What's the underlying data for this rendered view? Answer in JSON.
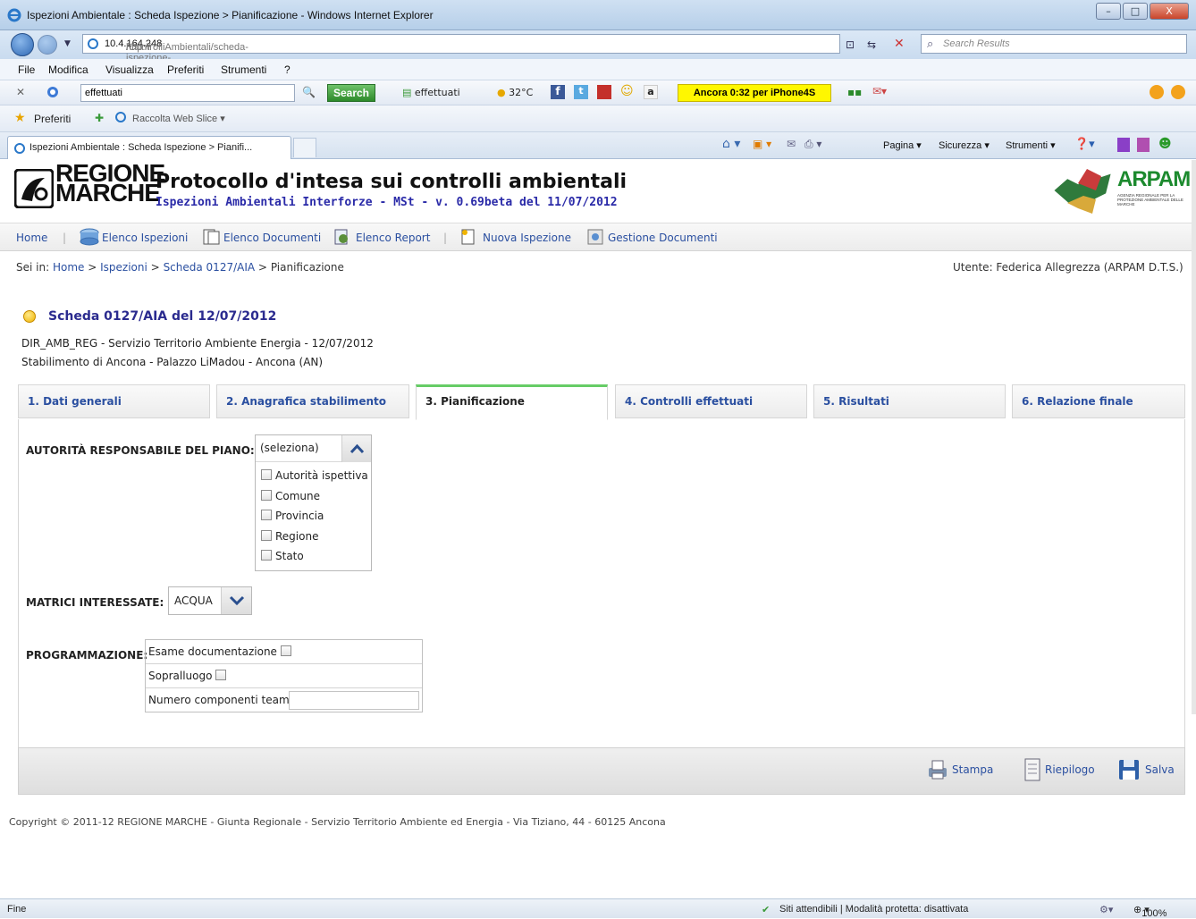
{
  "window": {
    "title": "Ispezioni Ambientale : Scheda Ispezione > Pianificazione - Windows Internet Explorer",
    "minimize": "–",
    "maximize": "□",
    "close": "X"
  },
  "address": {
    "url_prefix": "http://",
    "url_host": "10.4.164.248",
    "url_path": "/ControlliAmbientali/scheda-ispezione-pianificazione.aspx?ispIdIspezione=2764",
    "search_placeholder": "Search Results"
  },
  "menu": [
    "File",
    "Modifica",
    "Visualizza",
    "Preferiti",
    "Strumenti",
    "?"
  ],
  "toolbar": {
    "search_value": "effettuati",
    "search_button": "Search",
    "item_effettuati": "effettuati",
    "temperature": "32°C",
    "promo": "Ancora 0:32 per iPhone4S"
  },
  "favorites": {
    "preferiti": "Preferiti",
    "web_slice": "Raccolta Web Slice ▾"
  },
  "browser_tab": {
    "label": "Ispezioni Ambientale : Scheda Ispezione > Pianifi...",
    "commands": [
      "Pagina ▾",
      "Sicurezza ▾",
      "Strumenti ▾"
    ]
  },
  "site": {
    "logo_line1": "REGIONE",
    "logo_line2": "MARCHE",
    "title": "Protocollo d'intesa sui controlli ambientali",
    "subtitle": "Ispezioni Ambientali Interforze - MSt - v. 0.69beta del 11/07/2012",
    "partner_logo": "ARPAM",
    "partner_caption": "AGENZIA REGIONALE PER LA PROTEZIONE AMBIENTALE DELLE MARCHE"
  },
  "nav": {
    "home": "Home",
    "elenco_ispezioni": "Elenco Ispezioni",
    "elenco_documenti": "Elenco Documenti",
    "elenco_report": "Elenco Report",
    "nuova_ispezione": "Nuova Ispezione",
    "gestione_documenti": "Gestione Documenti"
  },
  "breadcrumb": {
    "prefix": "Sei in:",
    "home": "Home",
    "ispezioni": "Ispezioni",
    "scheda": "Scheda 0127/AIA",
    "current": "Pianificazione",
    "separator": ">"
  },
  "user": "Utente: Federica Allegrezza (ARPAM D.T.S.)",
  "scheda": {
    "title": "Scheda 0127/AIA del 12/07/2012",
    "line1": "DIR_AMB_REG - Servizio Territorio Ambiente Energia - 12/07/2012",
    "line2": "Stabilimento di Ancona - Palazzo LiMadou - Ancona (AN)"
  },
  "tabs": [
    {
      "label": "1. Dati generali",
      "active": false
    },
    {
      "label": "2. Anagrafica stabilimento",
      "active": false
    },
    {
      "label": "3. Pianificazione",
      "active": true
    },
    {
      "label": "4. Controlli effettuati",
      "active": false
    },
    {
      "label": "5. Risultati",
      "active": false
    },
    {
      "label": "6. Relazione finale",
      "active": false
    }
  ],
  "form": {
    "autorita_label": "AUTORITÀ RESPONSABILE DEL PIANO:",
    "autorita_selected": "(seleziona)",
    "autorita_options": [
      "Autorità ispettiva",
      "Comune",
      "Provincia",
      "Regione",
      "Stato"
    ],
    "matrici_label": "MATRICI INTERESSATE:",
    "matrici_value": "ACQUA",
    "programmazione_label": "PROGRAMMAZIONE:",
    "esame_label": "Esame documentazione",
    "sopralluogo_label": "Sopralluogo",
    "team_label": "Numero componenti team",
    "team_value": ""
  },
  "actions": {
    "stampa": "Stampa",
    "riepilogo": "Riepilogo",
    "salva": "Salva"
  },
  "footer": "Copyright © 2011-12 REGIONE MARCHE - Giunta Regionale - Servizio Territorio Ambiente ed Energia - Via Tiziano, 44 - 60125 Ancona",
  "status": {
    "left": "Fine",
    "zone": "Siti attendibili | Modalità protetta: disattivata",
    "zoom": "100%"
  },
  "colors": {
    "link": "#2a4fa0",
    "active_tab_accent": "#66cc66",
    "title_blue": "#2b2b8f",
    "arpam_green": "#1c8a2e"
  }
}
